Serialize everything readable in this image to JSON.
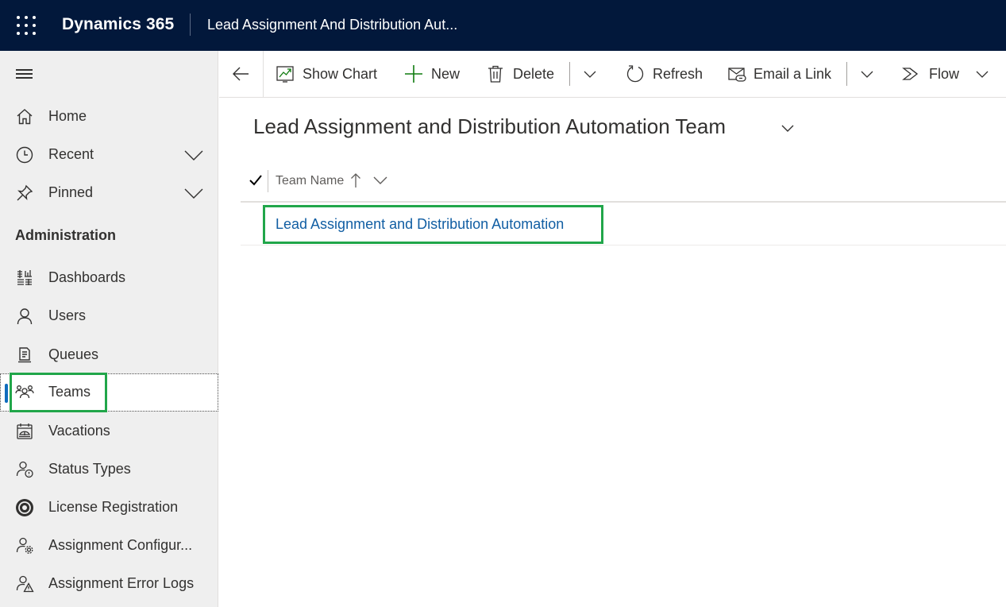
{
  "topbar": {
    "app_name": "Dynamics 365",
    "page_name": "Lead Assignment And Distribution Aut..."
  },
  "sidebar": {
    "items_top": [
      {
        "label": "Home",
        "icon": "home-icon"
      },
      {
        "label": "Recent",
        "icon": "clock-icon",
        "expandable": true
      },
      {
        "label": "Pinned",
        "icon": "pin-icon",
        "expandable": true
      }
    ],
    "section_title": "Administration",
    "items": [
      {
        "label": "Dashboards",
        "icon": "dashboard-icon"
      },
      {
        "label": "Users",
        "icon": "user-icon"
      },
      {
        "label": "Queues",
        "icon": "queue-icon"
      },
      {
        "label": "Teams",
        "icon": "teams-icon",
        "selected": true
      },
      {
        "label": "Vacations",
        "icon": "calendar-icon"
      },
      {
        "label": "Status Types",
        "icon": "status-types-icon"
      },
      {
        "label": "License Registration",
        "icon": "license-icon"
      },
      {
        "label": "Assignment Configur...",
        "icon": "user-settings-icon"
      },
      {
        "label": "Assignment Error Logs",
        "icon": "user-warning-icon"
      }
    ]
  },
  "commandbar": {
    "show_chart": "Show Chart",
    "new": "New",
    "delete": "Delete",
    "refresh": "Refresh",
    "email_link": "Email a Link",
    "flow": "Flow"
  },
  "view": {
    "title": "Lead Assignment and Distribution Automation Team",
    "columns": [
      {
        "label": "Team Name",
        "sort": "ascending"
      }
    ],
    "rows": [
      {
        "team_name": "Lead Assignment and Distribution Automation"
      }
    ]
  },
  "colors": {
    "topbar_bg": "#02183b",
    "sidebar_bg": "#efefef",
    "selected_indicator": "#0f6cbd",
    "highlight_box": "#21a64a",
    "link": "#115ea3"
  }
}
